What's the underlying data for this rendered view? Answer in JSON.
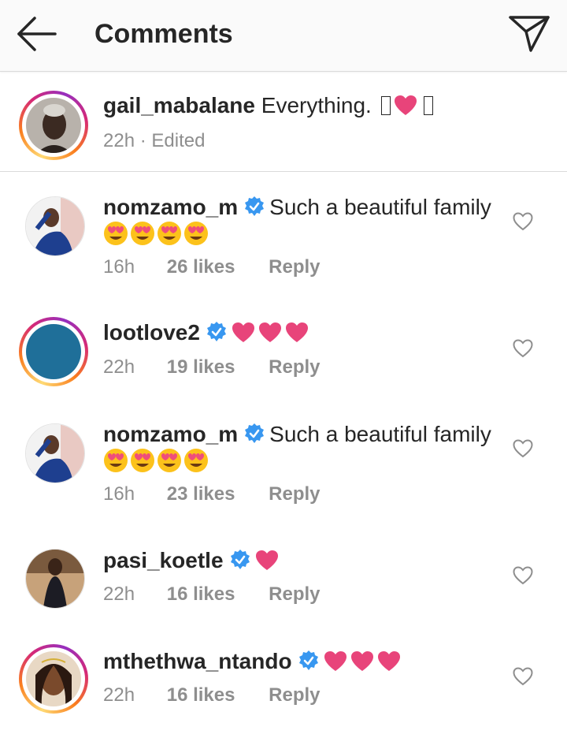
{
  "header": {
    "title": "Comments"
  },
  "caption": {
    "username": "gail_mabalane",
    "text": "Everything.",
    "time": "22h",
    "separator": "·",
    "edited": "Edited"
  },
  "comments": [
    {
      "username": "nomzamo_m",
      "verified": true,
      "text": "Such a beautiful family",
      "emoji": "😍😍😍😍",
      "time": "16h",
      "likes": "26 likes",
      "reply": "Reply"
    },
    {
      "username": "lootlove2",
      "verified": true,
      "text": "",
      "emoji": "❤❤❤",
      "time": "22h",
      "likes": "19 likes",
      "reply": "Reply"
    },
    {
      "username": "nomzamo_m",
      "verified": true,
      "text": "Such a beautiful family",
      "emoji": "😍😍😍😍",
      "time": "16h",
      "likes": "23 likes",
      "reply": "Reply"
    },
    {
      "username": "pasi_koetle",
      "verified": true,
      "text": "",
      "emoji": "❤",
      "time": "22h",
      "likes": "16 likes",
      "reply": "Reply"
    },
    {
      "username": "mthethwa_ntando",
      "verified": true,
      "text": "",
      "emoji": "❤❤❤",
      "time": "22h",
      "likes": "16 likes",
      "reply": "Reply"
    }
  ],
  "colors": {
    "verified": "#3897f0",
    "heart": "#e8447a",
    "meta": "#8e8e8e",
    "text": "#262626"
  },
  "icons": {
    "back": "arrow-left-icon",
    "send": "paper-plane-icon",
    "like": "heart-outline-icon"
  }
}
